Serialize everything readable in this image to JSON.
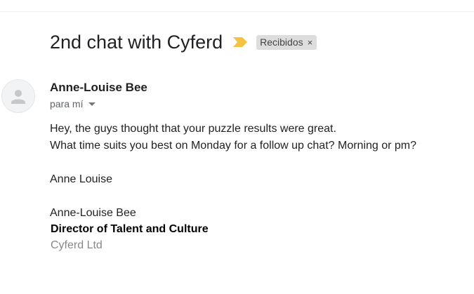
{
  "email": {
    "subject": "2nd chat with Cyferd",
    "label": "Recibidos",
    "label_remove_glyph": "×",
    "importance_color": "#f6c244",
    "sender_name": "Anne-Louise Bee",
    "recipient_text": "para mí",
    "body_lines": [
      "Hey, the guys thought that your puzzle results were great.",
      "What time suits you best on Monday for a follow up chat? Morning or pm?"
    ],
    "signoff": "Anne Louise",
    "signature": {
      "name": "Anne-Louise Bee",
      "title": "Director of Talent and Culture",
      "company": "Cyferd Ltd"
    },
    "icons": {
      "importance": "importance-marker-icon",
      "avatar": "default-avatar-icon",
      "details": "chevron-down-icon",
      "remove_label": "close-icon"
    }
  }
}
